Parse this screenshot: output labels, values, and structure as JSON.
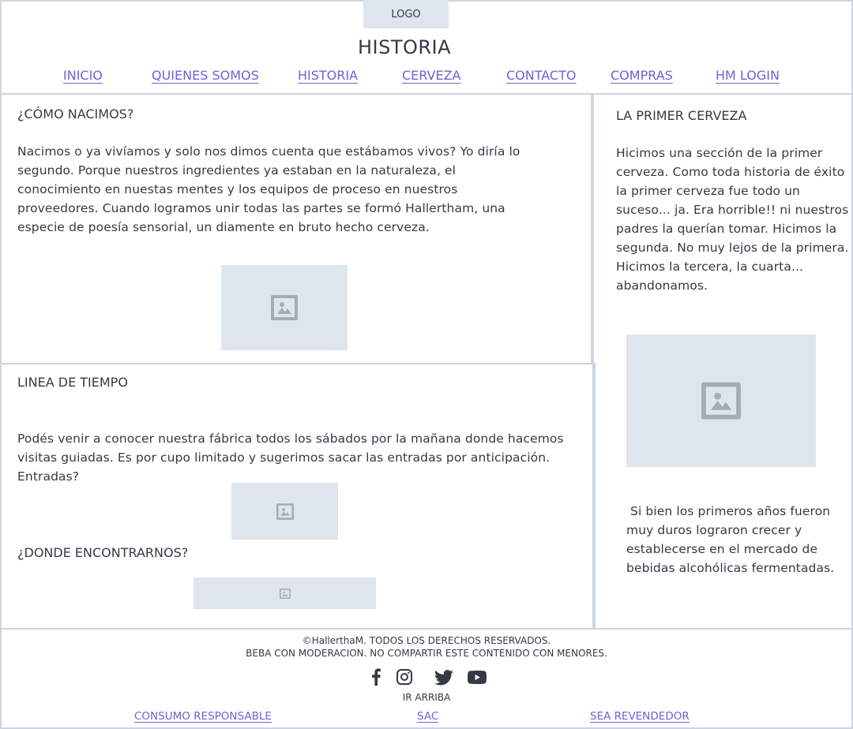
{
  "header": {
    "logo": "LOGO",
    "title": "HISTORIA",
    "nav": [
      "INICIO",
      "QUIENES SOMOS",
      "HISTORIA",
      "CERVEZA",
      "CONTACTO",
      "COMPRAS",
      "HM LOGIN"
    ]
  },
  "origin": {
    "heading": "¿CÓMO NACIMOS?",
    "text": "Nacimos o ya vivíamos y solo nos dimos cuenta que estábamos vivos? Yo diría lo segundo. Porque nuestros ingredientes ya estaban en la naturaleza, el conocimiento en nuestas mentes y los equipos de proceso en nuestros proveedores. Cuando logramos unir todas las partes se formó Hallertham, una especie de poesía sensorial, un diamente en bruto hecho cerveza."
  },
  "timeline": {
    "heading": "LINEA DE TIEMPO",
    "text": "Podés venir a conocer nuestra fábrica todos los sábados por la mañana donde hacemos visitas guiadas. Es por cupo limitado y sugerimos sacar las entradas por anticipación. Entradas?",
    "find_heading": "¿DONDE ENCONTRARNOS?"
  },
  "first_beer": {
    "heading": "LA PRIMER CERVEZA",
    "text": "Hicimos una sección de la primer cerveza. Como toda historia de éxito la primer cerveza fue todo un suceso... ja. Era horrible!! ni nuestros padres la querían tomar. Hicimos la segunda. No muy lejos de la primera. Hicimos la tercera, la cuarta... abandonamos.",
    "text2": " Si bien los primeros años fueron muy duros lograron crecer y establecerse en el mercado de bebidas alcohólicas fermentadas."
  },
  "footer": {
    "copyright": "©HallerthaM. TODOS LOS DERECHOS RESERVADOS.",
    "warning": "BEBA CON MODERACION. NO COMPARTIR ESTE CONTENIDO CON MENORES.",
    "social_icons": [
      "facebook-icon",
      "instagram-icon",
      "twitter-icon",
      "youtube-icon"
    ],
    "back_to_top": "IR ARRIBA",
    "links": [
      "CONSUMO RESPONSABLE",
      "SAC",
      "SEA REVENDEDOR"
    ]
  },
  "colors": {
    "link": "#6b63d8",
    "text": "#333a44",
    "border": "#cdd5df",
    "placeholder": "#dfe5ec"
  }
}
